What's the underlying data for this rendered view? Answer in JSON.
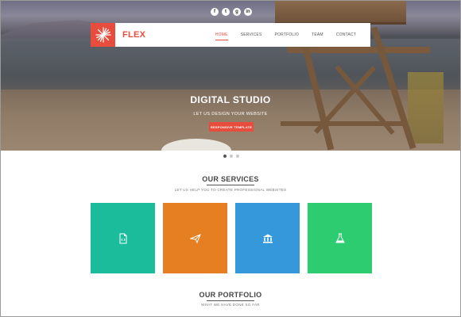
{
  "social": {
    "icons": [
      "facebook-icon",
      "twitter-icon",
      "google-plus-icon",
      "linkedin-icon"
    ],
    "glyphs": [
      "f",
      "t",
      "g",
      "in"
    ]
  },
  "navbar": {
    "brand": "FLEX",
    "menu": [
      {
        "label": "HOME",
        "active": true
      },
      {
        "label": "SERVICES",
        "active": false
      },
      {
        "label": "PORTFOLIO",
        "active": false
      },
      {
        "label": "TEAM",
        "active": false
      },
      {
        "label": "CONTACT",
        "active": false
      }
    ]
  },
  "hero": {
    "title": "DIGITAL STUDIO",
    "subtitle": "LET US DESIGN YOUR WEBSITE",
    "button": "RESPONSIVE TEMPLATE",
    "slides": 3,
    "active_slide": 1
  },
  "services": {
    "title": "OUR SERVICES",
    "subtitle": "LET US HELP YOU TO CREATE PROFESSIONAL WEBSITES",
    "tiles": [
      {
        "icon": "document-icon",
        "color": "#1abc9c"
      },
      {
        "icon": "paper-plane-icon",
        "color": "#e67e22"
      },
      {
        "icon": "bank-icon",
        "color": "#3498db"
      },
      {
        "icon": "flask-icon",
        "color": "#2ecc71"
      }
    ]
  },
  "portfolio": {
    "title": "OUR PORTFOLIO",
    "subtitle": "WHAT WE HAVE DONE SO FAR"
  },
  "colors": {
    "accent": "#e74c3c",
    "nav_bg": "#ffffff",
    "text_dark": "#444444"
  }
}
